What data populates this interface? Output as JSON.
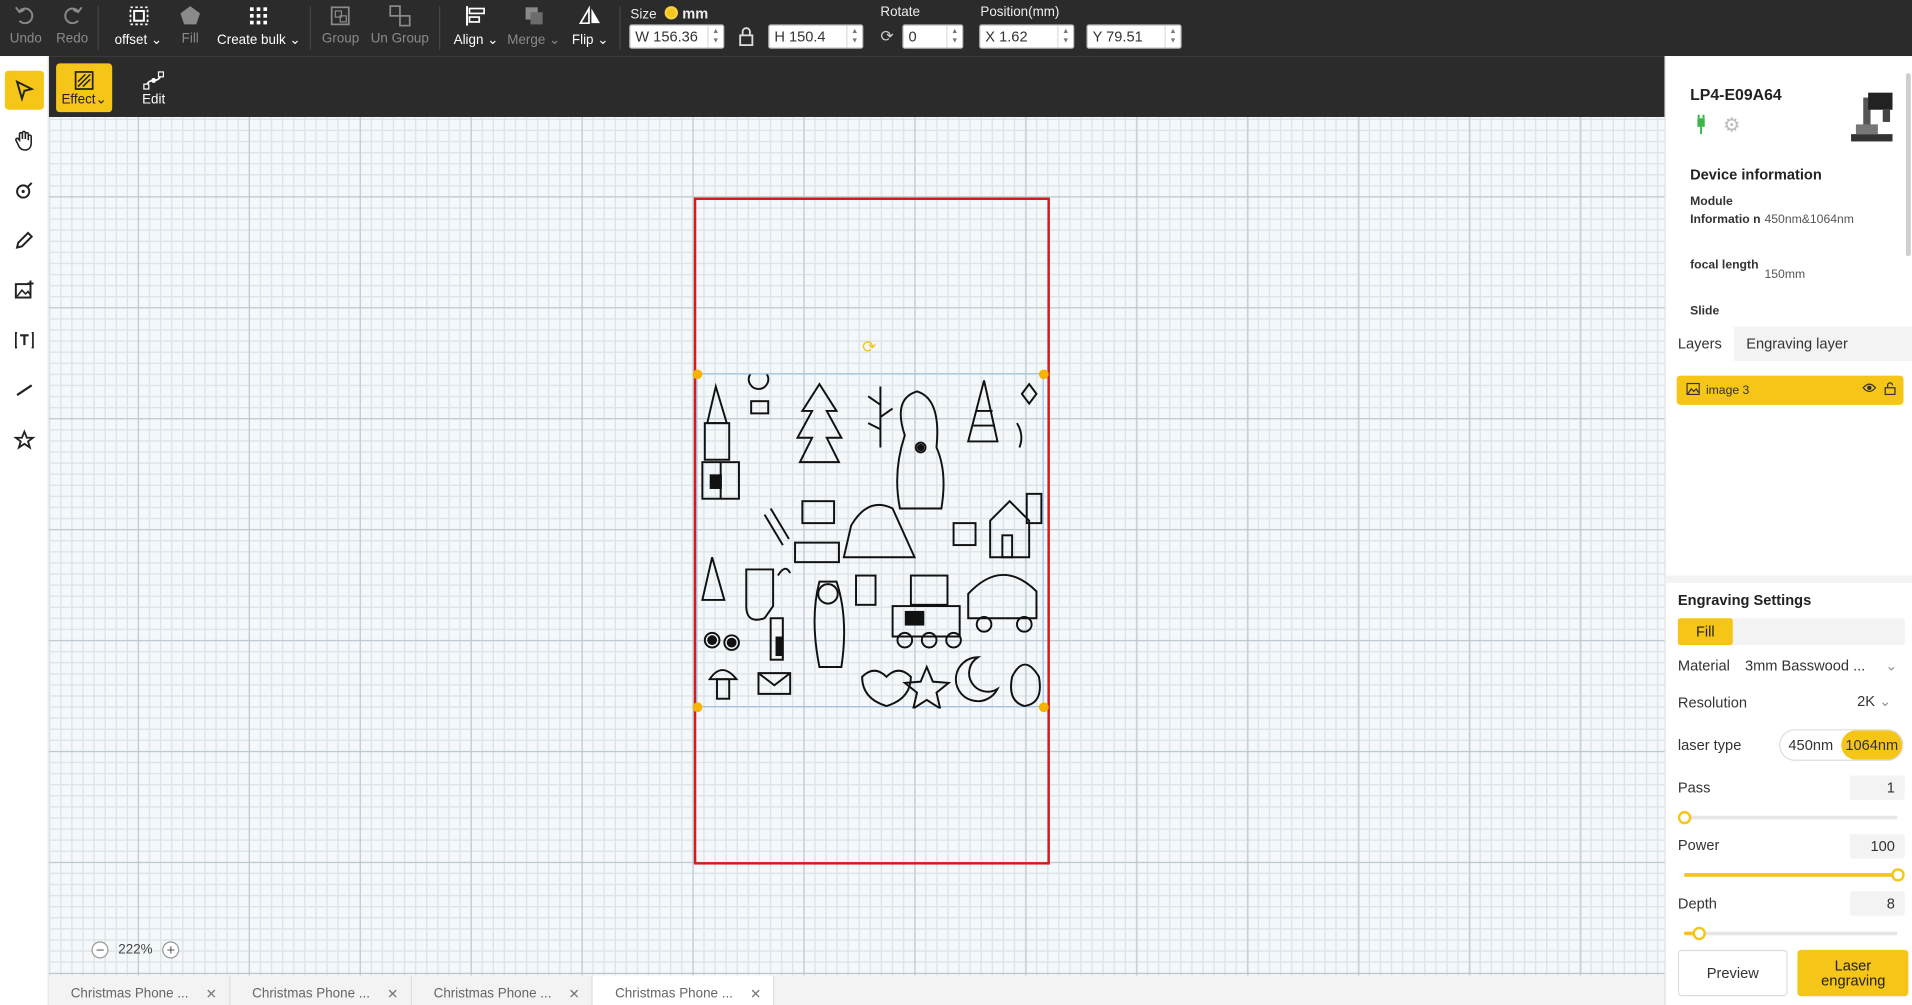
{
  "toolbar": {
    "undo": "Undo",
    "redo": "Redo",
    "offset": "offset",
    "fill": "Fill",
    "create_bulk": "Create bulk",
    "group": "Group",
    "ungroup": "Un Group",
    "align": "Align",
    "merge": "Merge",
    "flip": "Flip",
    "size_title": "Size",
    "unit": "mm",
    "width": "W 156.36",
    "height": "H 150.4",
    "rotate_title": "Rotate",
    "rotate_value": "0",
    "position_title": "Position(mm)",
    "pos_x": "X 1.62",
    "pos_y": "Y 79.51"
  },
  "secondary": {
    "effect": "Effect",
    "edit": "Edit"
  },
  "left_tools": [
    "select-tool",
    "hand-tool",
    "pen-tool",
    "pencil-tool",
    "image-tool",
    "text-tool",
    "line-tool",
    "shape-tool"
  ],
  "canvas": {
    "zoom": "222%"
  },
  "file_tabs": [
    "Christmas Phone ...",
    "Christmas Phone ...",
    "Christmas Phone ...",
    "Christmas Phone ..."
  ],
  "device": {
    "name": "LP4-E09A64",
    "info_title": "Device information",
    "module_label": "Module Informatio n",
    "module_value": "450nm&1064nm",
    "focal_label": "focal length",
    "focal_value": "150mm",
    "slide_label": "Slide"
  },
  "panels": {
    "layers_tab": "Layers",
    "engraving_layer_tab": "Engraving layer",
    "layer_name": "image 3"
  },
  "engraving": {
    "title": "Engraving Settings",
    "mode": "Fill",
    "material_label": "Material",
    "material_value": "3mm Basswood ...",
    "resolution_label": "Resolution",
    "resolution_value": "2K",
    "laser_type_label": "laser type",
    "laser_450": "450nm",
    "laser_1064": "1064nm",
    "pass_label": "Pass",
    "pass_value": "1",
    "pass_level": 0,
    "power_label": "Power",
    "power_value": "100",
    "power_level": 1,
    "depth_label": "Depth",
    "depth_value": "8",
    "depth_level": 0.07,
    "preview": "Preview",
    "laser_engraving": "Laser engraving"
  },
  "colors": {
    "accent": "#f5c518",
    "toolbar_bg": "#2b2b2b",
    "work_area_border": "#d61a1a"
  }
}
